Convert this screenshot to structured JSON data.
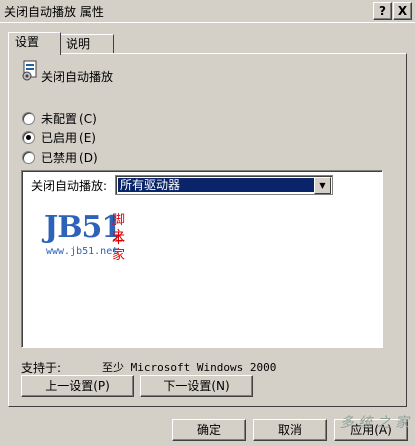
{
  "window": {
    "title": "关闭自动播放 属性",
    "help_label": "?",
    "close_label": "X"
  },
  "tabs": [
    {
      "label": "设置"
    },
    {
      "label": "说明"
    }
  ],
  "policy": {
    "title": "关闭自动播放",
    "icon": "policy-icon"
  },
  "radios": [
    {
      "label": "未配置",
      "accel": "(C)",
      "checked": false
    },
    {
      "label": "已启用",
      "accel": "(E)",
      "checked": true
    },
    {
      "label": "已禁用",
      "accel": "(D)",
      "checked": false
    }
  ],
  "options": {
    "label": "关闭自动播放:",
    "selected": "所有驱动器"
  },
  "watermark": {
    "logo": "JB51",
    "line1": "脚本",
    "line2": "之家",
    "url": "www.jb51.net",
    "corner": "多 统 之 家"
  },
  "supported": {
    "label": "支持于:",
    "value": "至少 Microsoft Windows 2000"
  },
  "nav": {
    "prev": "上一设置(P)",
    "next": "下一设置(N)"
  },
  "buttons": {
    "ok": "确定",
    "cancel": "取消",
    "apply": "应用(A)"
  }
}
